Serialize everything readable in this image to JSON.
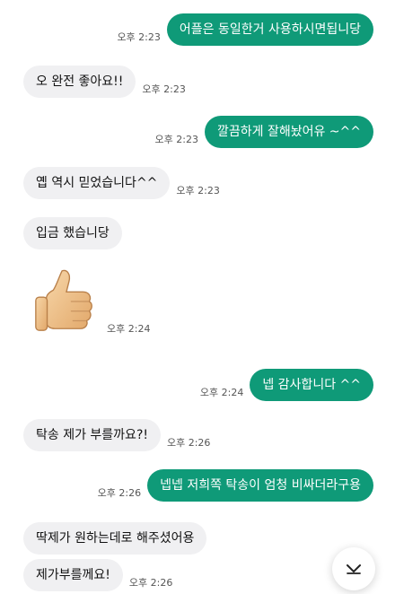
{
  "messages": [
    {
      "dir": "out",
      "text": "어플은 동일한거 사용하시면됩니당",
      "time": "오후 2:23"
    },
    {
      "dir": "in",
      "text": "오 완전 좋아요!!",
      "time": "오후 2:23"
    },
    {
      "dir": "out",
      "text": "깔끔하게 잘해놨어유 ~^^",
      "time": "오후 2:23"
    },
    {
      "dir": "in",
      "text": "옙 역시 믿었습니다^^",
      "time": "오후 2:23"
    },
    {
      "dir": "in",
      "text": "입금 했습니당",
      "time": ""
    },
    {
      "dir": "in",
      "sticker": "thumbs-up",
      "time": "오후 2:24"
    },
    {
      "dir": "out",
      "text": "넵 감사합니다 ^^",
      "time": "오후 2:24"
    },
    {
      "dir": "in",
      "text": "탁송 제가 부를까요?!",
      "time": "오후 2:26"
    },
    {
      "dir": "out",
      "text": "넵넵 저희쪽 탁송이 엄청 비싸더라구용",
      "time": "오후 2:26"
    },
    {
      "dir": "in",
      "text": "딱제가 원하는데로 해주셨어용",
      "time": ""
    },
    {
      "dir": "in",
      "text": "제가부를께요!",
      "time": "오후 2:26"
    }
  ],
  "icons": {
    "scroll_down": "chevron-down-icon",
    "sticker": "thumbs-up-icon"
  },
  "colors": {
    "outgoing_bubble": "#0f9a78",
    "incoming_bubble": "#f0f0f2",
    "background": "#ffffff"
  }
}
